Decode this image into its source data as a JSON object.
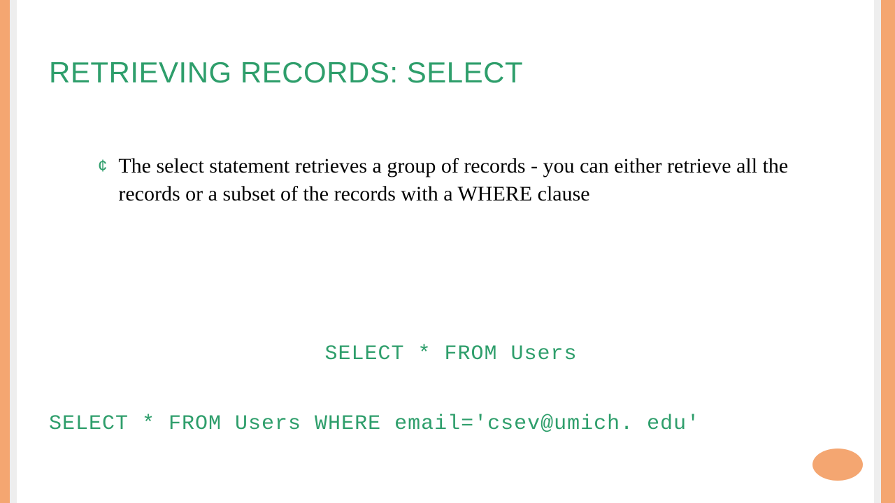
{
  "title": "RETRIEVING RECORDS: SELECT",
  "bullet": {
    "marker": "¢",
    "text": "The select statement retrieves a group of records - you can either retrieve all the records or a subset of the records with a WHERE clause"
  },
  "code": {
    "line1": "SELECT * FROM Users",
    "line2": "SELECT * FROM Users WHERE email='csev@umich. edu'"
  },
  "colors": {
    "accent_green": "#2e9e6b",
    "accent_orange": "#f4a671"
  }
}
